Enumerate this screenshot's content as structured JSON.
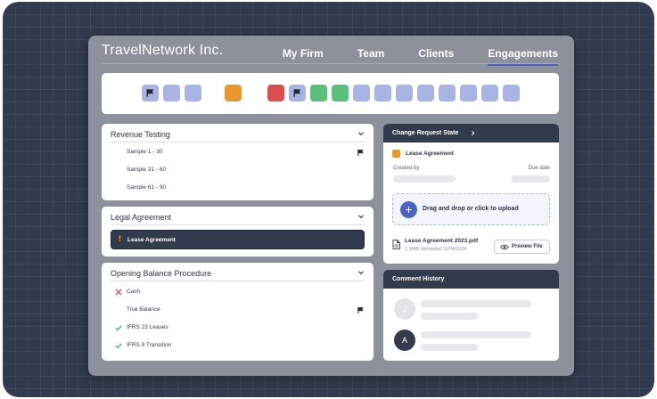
{
  "header": {
    "brand": "TravelNetwork Inc.",
    "nav": [
      "My Firm",
      "Team",
      "Clients",
      "Engagements"
    ],
    "active_nav": "Engagements"
  },
  "timeline": {
    "steps": [
      {
        "color": "#aab4e4",
        "flag": true
      },
      {
        "color": "#aab4e4",
        "flag": false
      },
      {
        "color": "#aab4e4",
        "flag": false
      },
      {
        "color": "#e8982e",
        "flag": false
      },
      {
        "color": "#d94f4f",
        "flag": false
      },
      {
        "color": "#aab4e4",
        "flag": true
      },
      {
        "color": "#5bbf7e",
        "flag": false
      },
      {
        "color": "#5bbf7e",
        "flag": false
      },
      {
        "color": "#aab4e4",
        "flag": false
      },
      {
        "color": "#aab4e4",
        "flag": false
      },
      {
        "color": "#aab4e4",
        "flag": false
      },
      {
        "color": "#aab4e4",
        "flag": false
      },
      {
        "color": "#aab4e4",
        "flag": false
      },
      {
        "color": "#aab4e4",
        "flag": false
      },
      {
        "color": "#aab4e4",
        "flag": false
      },
      {
        "color": "#aab4e4",
        "flag": false
      }
    ]
  },
  "revenue_testing": {
    "title": "Revenue Testing",
    "rows": [
      "Sample 1 - 30",
      "Sample 31 - 60",
      "Sample 61 - 90"
    ]
  },
  "legal_agreement": {
    "title": "Legal Agreement",
    "alert_mark": "!",
    "selected": "Lease Agreement"
  },
  "opening_balance": {
    "title": "Opening Balance Procedure",
    "rows": [
      {
        "label": "Cash",
        "status": "failed"
      },
      {
        "label": "Trial Balance",
        "status": "flagged"
      },
      {
        "label": "IFRS 23 Leases",
        "status": "passed"
      },
      {
        "label": "IFRS 9 Transition",
        "status": "passed"
      }
    ]
  },
  "change_request": {
    "title": "Change Request State",
    "item": "Lease Agreement",
    "item_color": "#e8982e",
    "created_by_label": "Created by",
    "due_date_label": "Due date",
    "drop_text": "Drag and drop or click to upload",
    "file_name": "Lease Agreement 2023.pdf",
    "file_meta": "1.9MB Uploaded 11/04/2024",
    "preview_label": "Preview File"
  },
  "comment_history": {
    "title": "Comment History",
    "avatars": [
      "J",
      "A"
    ]
  },
  "colors": {
    "backdrop": "#323a4d",
    "accent": "#4e62c6",
    "success": "#43b26f",
    "danger": "#d94f4f",
    "warning": "#e8982e"
  }
}
